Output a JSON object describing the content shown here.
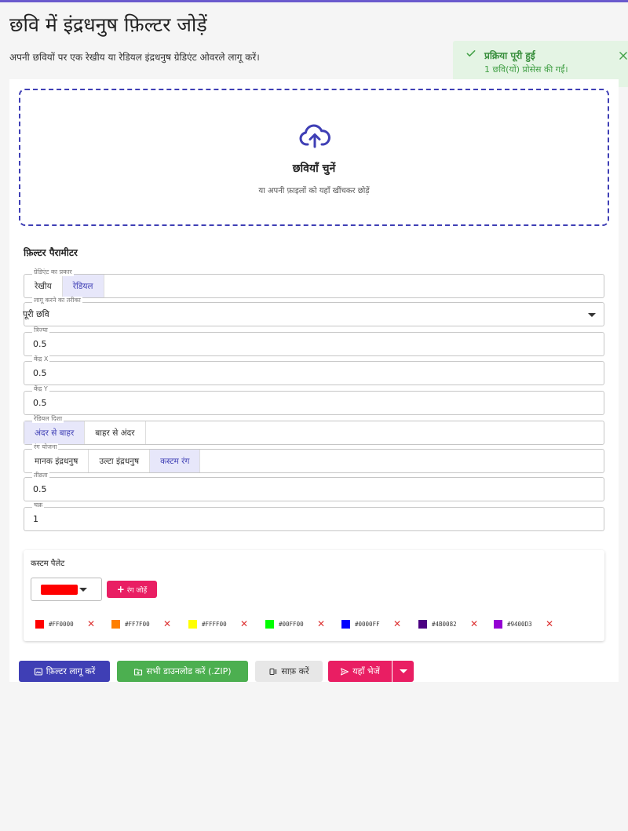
{
  "page": {
    "title": "छवि में इंद्रधनुष फ़िल्टर जोड़ें",
    "description": "अपनी छवियों पर एक रेखीय या रेडियल इंद्रधनुष ग्रेडिएंट ओवरले लागू करें।"
  },
  "toast": {
    "title": "प्रक्रिया पूरी हुई",
    "message": "1 छवि(यों) प्रोसेस की गईं।"
  },
  "upload": {
    "title": "छवियाँ चुनें",
    "subtitle": "या अपनी फ़ाइलों को यहाँ खींचकर छोड़ें"
  },
  "params": {
    "section_title": "फ़िल्टर पैरामीटर",
    "gradient_type": {
      "label": "ग्रेडिएंट का प्रकार",
      "options": [
        "रेखीय",
        "रेडियल"
      ],
      "selected": "रेडियल"
    },
    "apply_mode": {
      "label": "लागू करने का तरीका",
      "value": "पूरी छवि"
    },
    "radius": {
      "label": "त्रिज्या",
      "value": "0.5"
    },
    "center_x": {
      "label": "केंद्र X",
      "value": "0.5"
    },
    "center_y": {
      "label": "केंद्र Y",
      "value": "0.5"
    },
    "radial_direction": {
      "label": "रेडियल दिशा",
      "options": [
        "अंदर से बाहर",
        "बाहर से अंदर"
      ],
      "selected": "अंदर से बाहर"
    },
    "color_scheme": {
      "label": "रंग योजना",
      "options": [
        "मानक इंद्रधनुष",
        "उल्टा इंद्रधनुष",
        "कस्टम रंग"
      ],
      "selected": "कस्टम रंग"
    },
    "intensity": {
      "label": "तीव्रता",
      "value": "0.5"
    },
    "cycles": {
      "label": "चक्र",
      "value": "1"
    }
  },
  "palette": {
    "title": "कस्टम पैलेट",
    "picker_color": "#FF0000",
    "add_label": "रंग जोड़ें",
    "colors": [
      "#FF0000",
      "#FF7F00",
      "#FFFF00",
      "#00FF00",
      "#0000FF",
      "#4B0082",
      "#9400D3"
    ]
  },
  "actions": {
    "apply": "फ़िल्टर लागू करें",
    "download_all": "सभी डाउनलोड करें (.ZIP)",
    "clear": "साफ़ करें",
    "send": "यहाँ भेजें"
  },
  "colors": {
    "primary": "#3f3fb5",
    "success": "#4caf50",
    "accent": "#e91e63"
  }
}
